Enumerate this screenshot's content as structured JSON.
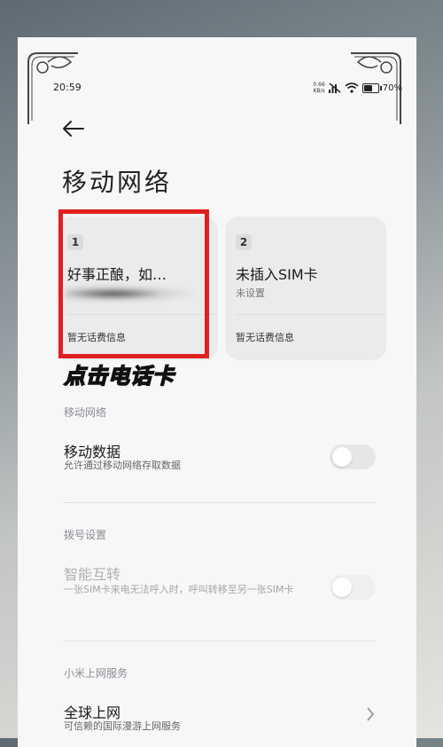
{
  "status_bar": {
    "time": "20:59",
    "net_speed_value": "0.66",
    "net_speed_unit": "KB/s",
    "battery": "70%"
  },
  "header": {
    "title": "移动网络"
  },
  "sim_cards": [
    {
      "slot": "1",
      "name": "好事正酿，如…",
      "subtitle": "",
      "billing": "暂无话费信息"
    },
    {
      "slot": "2",
      "name": "未插入SIM卡",
      "subtitle": "未设置",
      "billing": "暂无话费信息"
    }
  ],
  "overlay": {
    "tip": "点击电话卡",
    "highlight_color": "#e0201f"
  },
  "sections": {
    "mobile_network": {
      "header": "移动网络",
      "mobile_data": {
        "title": "移动数据",
        "desc": "允许通过移动网络存取数据",
        "enabled": false
      }
    },
    "dial_settings": {
      "header": "拨号设置",
      "smart_forward": {
        "title": "智能互转",
        "desc": "一张SIM卡来电无法呼入时，呼叫转移至另一张SIM卡",
        "enabled": false
      }
    },
    "xiaomi_service": {
      "header": "小米上网服务",
      "global_internet": {
        "title": "全球上网",
        "desc": "可信赖的国际漫游上网服务"
      }
    }
  },
  "icons": {
    "back": "arrow-left-icon",
    "signal": "no-signal-icon",
    "wifi": "wifi-icon",
    "battery": "battery-icon",
    "chevron": "chevron-right-icon"
  }
}
